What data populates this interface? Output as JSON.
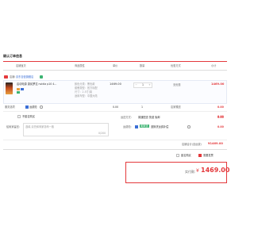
{
  "page_title": "确认订单信息",
  "columns": [
    "店铺宝贝",
    "商品属性",
    "单价",
    "数量",
    "优惠方式",
    "小计"
  ],
  "shop": {
    "label": "店铺:",
    "name": "京东自营旗舰店"
  },
  "product": {
    "title": "启动电源 康民罗拉 nvidia p10 4...",
    "attrs": [
      "颜色分类：黑色款",
      "套餐类型：官方标配",
      "尺寸：2.5寸/英",
      "适用车型：中国大陆"
    ],
    "unit_price": "1469.00",
    "quantity": "1",
    "discount": "无优惠",
    "subtotal": "1469.00"
  },
  "service": {
    "label": "服务选项",
    "option": "运费险",
    "price": "0.00",
    "qty": "1",
    "discount": "店家赠送",
    "subtotal": "0.00"
  },
  "anonymous": {
    "label": "不匿名购买",
    "subtotal": "0.00"
  },
  "message": {
    "label": "给卖家留言:",
    "placeholder": "选填,请先和商家协商一致",
    "counter": "0/200"
  },
  "delivery": {
    "label": "运送方式:",
    "method": "普通配送 快递 免邮",
    "subtotal": "0.00"
  },
  "shipping_ins": {
    "label": "运费险:",
    "tag": "卖家送",
    "desc": "退换货运费补偿",
    "subtotal": "0.00"
  },
  "shop_total": {
    "label": "店铺合计(含运费)",
    "value": "¥1469.00"
  },
  "options": {
    "anon_label": "匿名购买",
    "invoice_label": "需要发票"
  },
  "payment": {
    "label": "实付款:",
    "currency": "¥",
    "amount": "1469.00"
  },
  "colors": {
    "accent": "#e4393c",
    "blue": "#3b6fd6",
    "green": "#3cb371",
    "border": "#dddddd"
  }
}
